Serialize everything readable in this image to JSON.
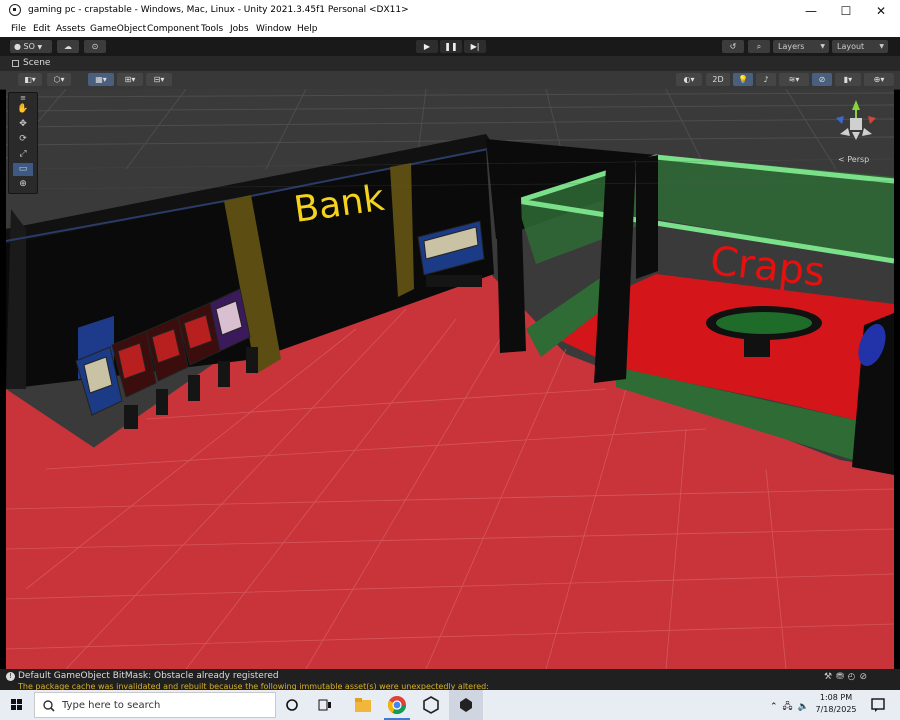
{
  "window": {
    "title": "gaming pc - crapstable - Windows, Mac, Linux - Unity 2021.3.45f1 Personal <DX11>",
    "minimize": "—",
    "maximize": "☐",
    "close": "✕"
  },
  "menu": [
    "File",
    "Edit",
    "Assets",
    "GameObject",
    "Component",
    "Tools",
    "Jobs",
    "Window",
    "Help"
  ],
  "toolbar": {
    "account": "SO",
    "layers": "Layers",
    "layout": "Layout"
  },
  "scene_tab": {
    "label": "Scene"
  },
  "scene_toolbar": {
    "mode_2d": "2D"
  },
  "gizmo": {
    "persp_label": "< Persp"
  },
  "scene": {
    "bank_sign": "Bank",
    "craps_sign": "Craps"
  },
  "status": {
    "message": "Default GameObject BitMask: Obstacle already registered",
    "warning": "The package cache was invalidated and rebuilt because the following immutable asset(s) were unexpectedly altered:"
  },
  "taskbar": {
    "search_placeholder": "Type here to search",
    "time": "1:08 PM",
    "date": "7/18/2025"
  },
  "colors": {
    "floor": "#c9343a",
    "wall_black": "#0a0a0a",
    "pillar": "#5c4e12",
    "bank_text": "#f5d21c",
    "craps_text": "#e80f0f",
    "craps_green": "#2e6b35"
  }
}
